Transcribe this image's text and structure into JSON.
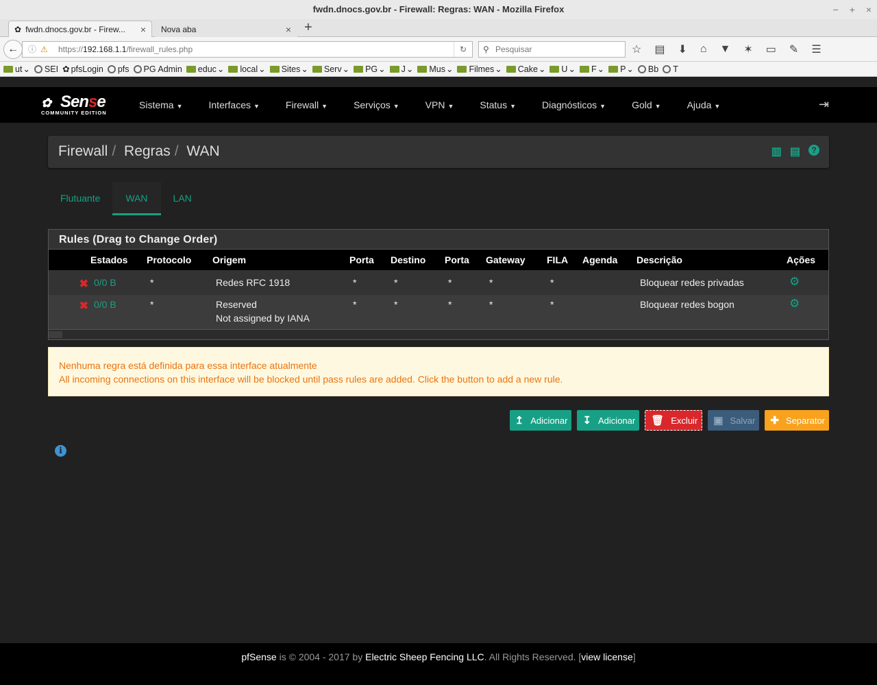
{
  "window": {
    "title": "fwdn.dnocs.gov.br - Firewall: Regras: WAN - Mozilla Firefox",
    "controls": [
      "−",
      "+",
      "×"
    ]
  },
  "tabs": [
    {
      "label": "fwdn.dnocs.gov.br - Firew...",
      "close": "×"
    },
    {
      "label": "Nova aba",
      "close": "×"
    }
  ],
  "newtab": "+",
  "url": {
    "prefix": "https://",
    "host": "192.168.1.1",
    "path": "/firewall_rules.php"
  },
  "search": {
    "placeholder": "Pesquisar"
  },
  "bookmarks": [
    {
      "label": "ut",
      "icon": "folder",
      "menu": true
    },
    {
      "label": "SEI",
      "icon": "globe",
      "menu": false
    },
    {
      "label": "pfsLogin",
      "icon": "pfsense",
      "menu": false
    },
    {
      "label": "pfs",
      "icon": "globe",
      "menu": false
    },
    {
      "label": "PG Admin",
      "icon": "globe",
      "menu": false
    },
    {
      "label": "educ",
      "icon": "folder",
      "menu": true
    },
    {
      "label": "local",
      "icon": "folder",
      "menu": true
    },
    {
      "label": "Sites",
      "icon": "folder",
      "menu": true
    },
    {
      "label": "Serv",
      "icon": "folder",
      "menu": true
    },
    {
      "label": "PG",
      "icon": "folder",
      "menu": true
    },
    {
      "label": "J",
      "icon": "folder",
      "menu": true
    },
    {
      "label": "Mus",
      "icon": "folder",
      "menu": true
    },
    {
      "label": "Filmes",
      "icon": "folder",
      "menu": true
    },
    {
      "label": "Cake",
      "icon": "folder",
      "menu": true
    },
    {
      "label": "U",
      "icon": "folder",
      "menu": true
    },
    {
      "label": "F",
      "icon": "folder",
      "menu": true
    },
    {
      "label": "P",
      "icon": "folder",
      "menu": true
    },
    {
      "label": "Bb",
      "icon": "globe",
      "menu": false
    },
    {
      "label": "T",
      "icon": "globe",
      "menu": false
    }
  ],
  "logo": {
    "word_a": "Sen",
    "word_b": "s",
    "word_c": "e",
    "sub": "COMMUNITY EDITION"
  },
  "menu": [
    "Sistema",
    "Interfaces",
    "Firewall",
    "Serviços",
    "VPN",
    "Status",
    "Diagnósticos",
    "Gold",
    "Ajuda"
  ],
  "breadcrumb": [
    "Firewall",
    "Regras",
    "WAN"
  ],
  "interface_tabs": [
    "Flutuante",
    "WAN",
    "LAN"
  ],
  "panel_title": "Rules (Drag to Change Order)",
  "columns": [
    "Estados",
    "Protocolo",
    "Origem",
    "Porta",
    "Destino",
    "Porta",
    "Gateway",
    "FILA",
    "Agenda",
    "Descrição",
    "Ações"
  ],
  "rules": [
    {
      "states": "0/0 B",
      "protocol": "*",
      "source": "Redes RFC 1918",
      "source2": "",
      "sport": "*",
      "dest": "*",
      "dport": "*",
      "gateway": "*",
      "queue": "*",
      "schedule": "",
      "description": "Bloquear redes privadas"
    },
    {
      "states": "0/0 B",
      "protocol": "*",
      "source": "Reserved",
      "source2": "Not assigned by IANA",
      "sport": "*",
      "dest": "*",
      "dport": "*",
      "gateway": "*",
      "queue": "*",
      "schedule": "",
      "description": "Bloquear redes bogon"
    }
  ],
  "alert": {
    "line1": "Nenhuma regra está definida para essa interface atualmente",
    "line2": "All incoming connections on this interface will be blocked until pass rules are added. Click the button to add a new rule."
  },
  "buttons": {
    "add_top": "Adicionar",
    "add_bottom": "Adicionar",
    "delete": "Excluir",
    "save": "Salvar",
    "separator": "Separator"
  },
  "footer": {
    "brand": "pfSense",
    "text1": " is © 2004 - 2017 by ",
    "company": "Electric Sheep Fencing LLC",
    "text2": ". All Rights Reserved. [",
    "license": "view license",
    "text3": "]"
  },
  "colors": {
    "accent": "#17a085",
    "danger": "#d9282b",
    "warning": "#f8a21d",
    "info": "#3e93d2"
  }
}
